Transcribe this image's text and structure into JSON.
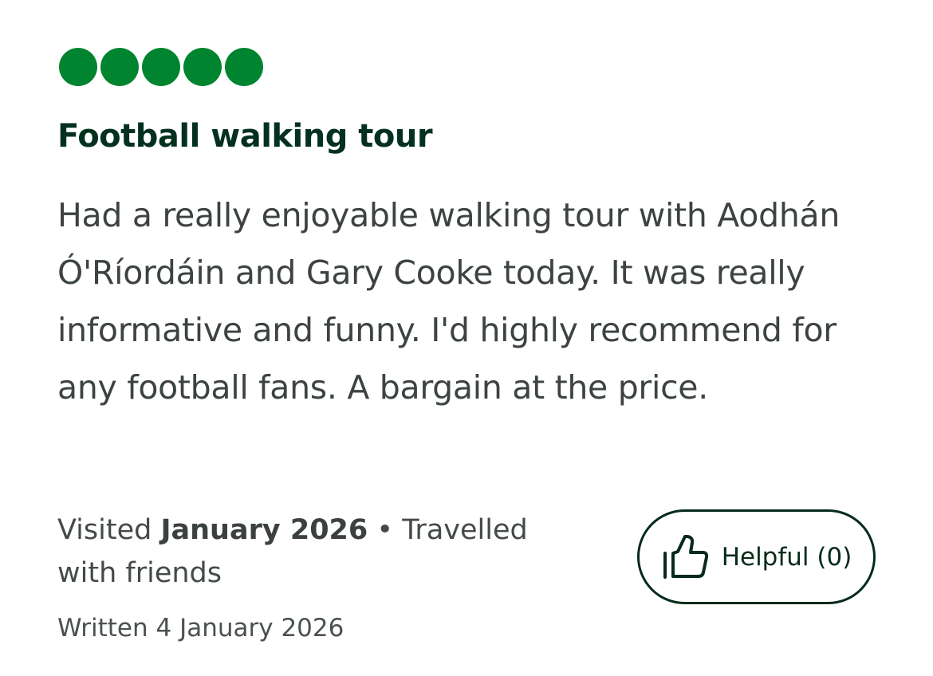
{
  "review": {
    "rating_value": 5,
    "rating_max": 5,
    "rating_color": "#00842f",
    "title": "Football walking tour",
    "body": "Had a really enjoyable walking tour with Aodhán Ó'Ríordáin and Gary Cooke today. It was really informative and funny. I'd highly recommend for any football fans. A bargain at the price.",
    "visited_prefix": "Visited",
    "visited_date": "January 2026",
    "separator": "•",
    "travel_type": "Travelled with friends",
    "written": "Written 4 January 2026"
  },
  "actions": {
    "helpful_label": "Helpful (0)",
    "helpful_icon": "thumbs-up-icon"
  }
}
